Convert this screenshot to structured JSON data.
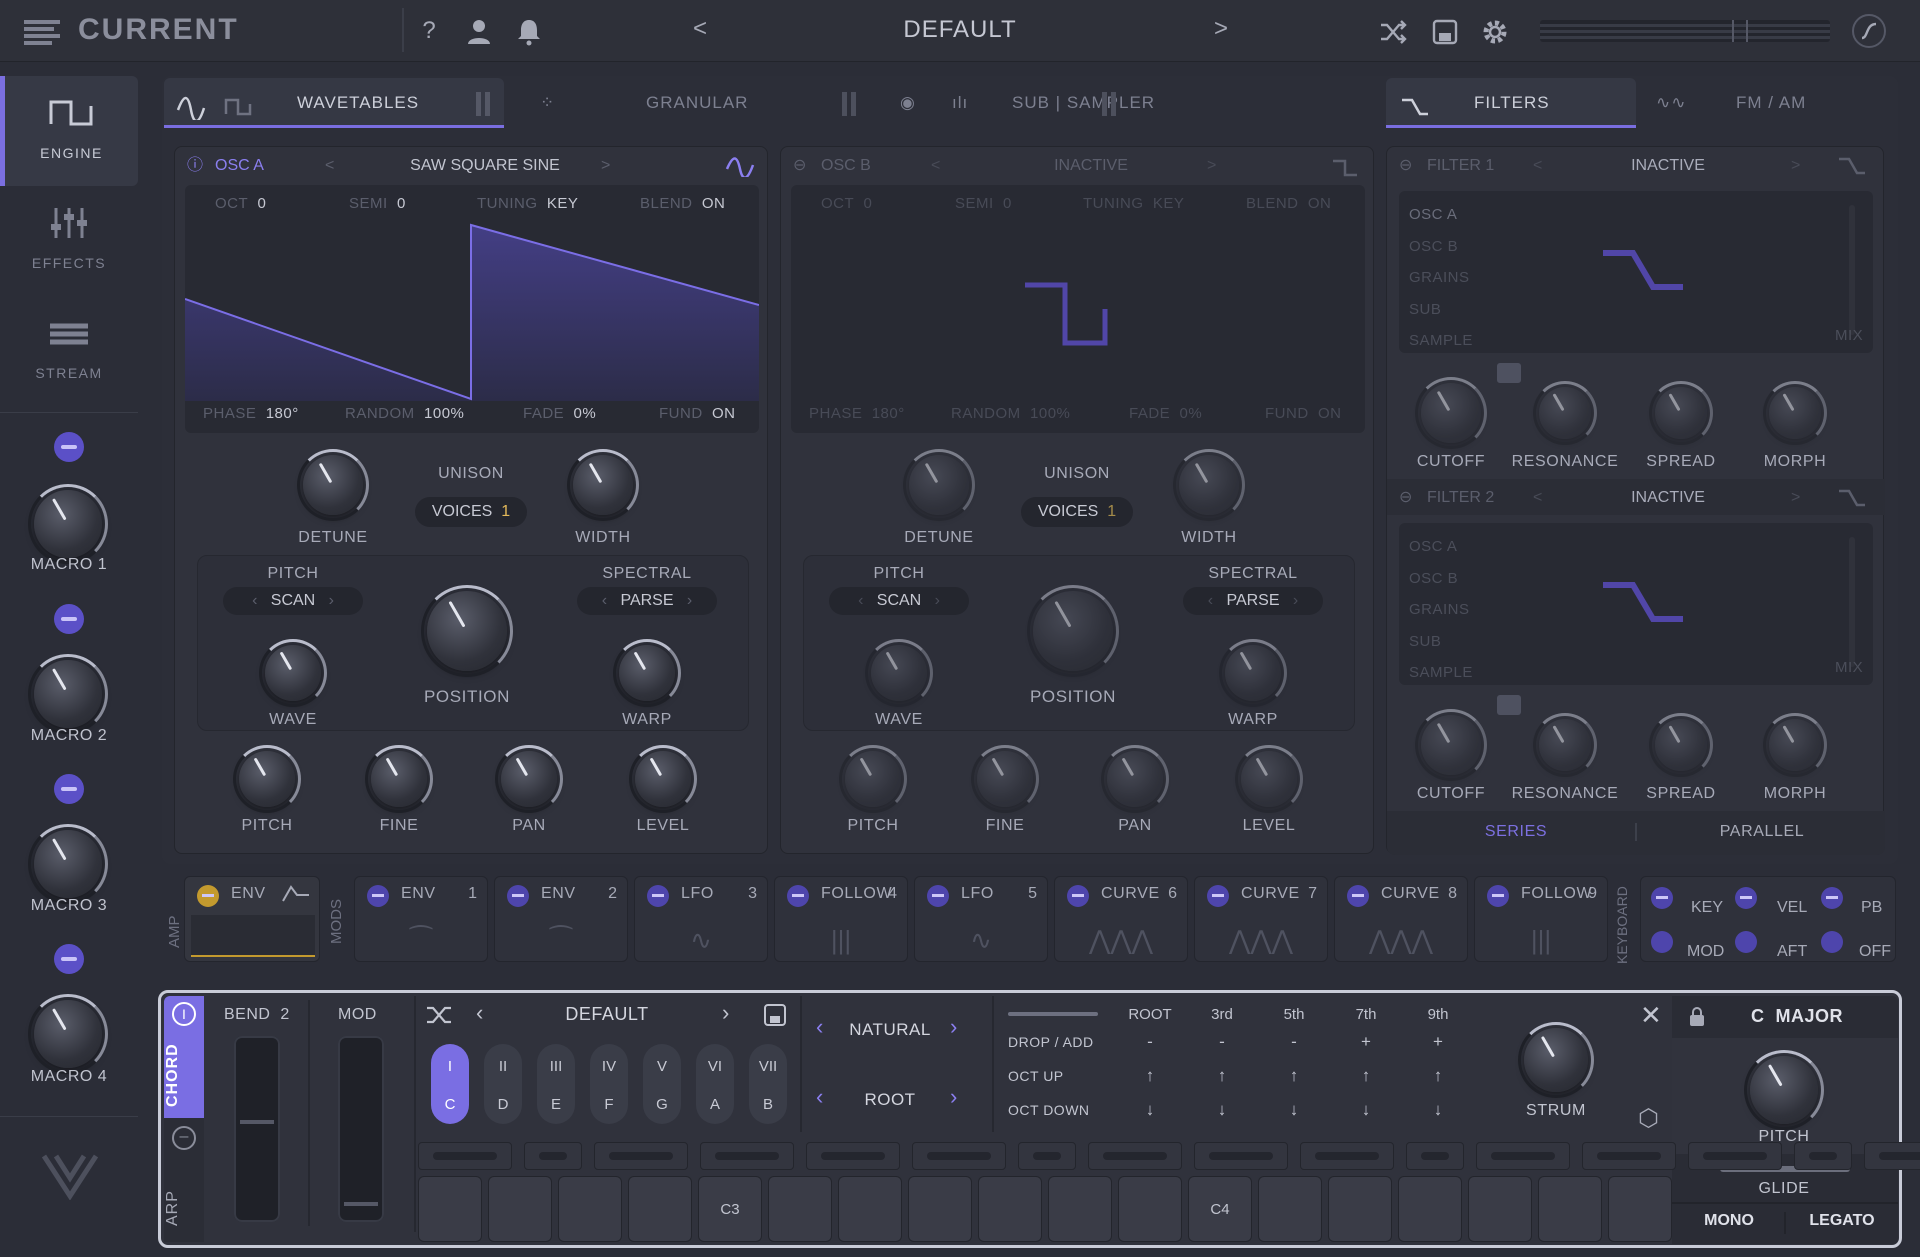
{
  "app": {
    "logo": "CURRENT",
    "preset": "DEFAULT"
  },
  "topbar": {
    "icons": [
      "help-icon",
      "user-icon",
      "bell-icon",
      "prev-chevron-icon",
      "next-chevron-icon",
      "shuffle-icon",
      "save-icon",
      "gear-icon",
      "curve-icon"
    ],
    "help_glyph": "?",
    "prev": "<",
    "next": ">"
  },
  "nav": {
    "items": [
      {
        "label": "ENGINE",
        "icon": "square-wave-icon"
      },
      {
        "label": "EFFECTS",
        "icon": "sliders-icon"
      },
      {
        "label": "STREAM",
        "icon": "stream-icon"
      }
    ]
  },
  "macros": [
    "MACRO 1",
    "MACRO 2",
    "MACRO 3",
    "MACRO 4"
  ],
  "tabs": {
    "wavetables": "WAVETABLES",
    "granular": "GRANULAR",
    "sub_sampler": "SUB | SAMPLER",
    "filters": "FILTERS",
    "fm_am": "FM / AM"
  },
  "osc_a": {
    "name": "OSC A",
    "wavetable": "SAW SQUARE SINE",
    "params": [
      {
        "k": "OCT",
        "v": "0"
      },
      {
        "k": "SEMI",
        "v": "0"
      },
      {
        "k": "TUNING",
        "v": "KEY"
      },
      {
        "k": "BLEND",
        "v": "ON"
      }
    ],
    "footer": [
      {
        "k": "PHASE",
        "v": "180°"
      },
      {
        "k": "RANDOM",
        "v": "100%"
      },
      {
        "k": "FADE",
        "v": "0%"
      },
      {
        "k": "FUND",
        "v": "ON"
      }
    ],
    "unison": "UNISON",
    "voices_label": "VOICES",
    "voices": "1",
    "detune": "DETUNE",
    "width": "WIDTH",
    "pitch_mode": "PITCH",
    "spectral_mode": "SPECTRAL",
    "scan": "SCAN",
    "parse": "PARSE",
    "wave": "WAVE",
    "position": "POSITION",
    "warp": "WARP",
    "bottom": [
      "PITCH",
      "FINE",
      "PAN",
      "LEVEL"
    ]
  },
  "osc_b": {
    "name": "OSC B",
    "wavetable": "INACTIVE",
    "params": [
      {
        "k": "OCT",
        "v": "0"
      },
      {
        "k": "SEMI",
        "v": "0"
      },
      {
        "k": "TUNING",
        "v": "KEY"
      },
      {
        "k": "BLEND",
        "v": "ON"
      }
    ],
    "footer": [
      {
        "k": "PHASE",
        "v": "180°"
      },
      {
        "k": "RANDOM",
        "v": "100%"
      },
      {
        "k": "FADE",
        "v": "0%"
      },
      {
        "k": "FUND",
        "v": "ON"
      }
    ],
    "unison": "UNISON",
    "voices_label": "VOICES",
    "voices": "1",
    "detune": "DETUNE",
    "width": "WIDTH",
    "pitch_mode": "PITCH",
    "spectral_mode": "SPECTRAL",
    "scan": "SCAN",
    "parse": "PARSE",
    "wave": "WAVE",
    "position": "POSITION",
    "warp": "WARP",
    "bottom": [
      "PITCH",
      "FINE",
      "PAN",
      "LEVEL"
    ]
  },
  "filter1": {
    "name": "FILTER 1",
    "type": "INACTIVE",
    "sources": [
      "OSC A",
      "OSC B",
      "GRAINS",
      "SUB",
      "SAMPLE"
    ],
    "mix": "MIX",
    "knobs": [
      "CUTOFF",
      "RESONANCE",
      "SPREAD",
      "MORPH"
    ]
  },
  "filter2": {
    "name": "FILTER 2",
    "type": "INACTIVE",
    "sources": [
      "OSC A",
      "OSC B",
      "GRAINS",
      "SUB",
      "SAMPLE"
    ],
    "mix": "MIX",
    "knobs": [
      "CUTOFF",
      "RESONANCE",
      "SPREAD",
      "MORPH"
    ]
  },
  "routing": {
    "series": "SERIES",
    "parallel": "PARALLEL"
  },
  "amp": {
    "label": "AMP",
    "env": "ENV"
  },
  "mods_label": "MODS",
  "mods": [
    {
      "name": "ENV",
      "num": "1",
      "wave": "⁀"
    },
    {
      "name": "ENV",
      "num": "2",
      "wave": "⁀"
    },
    {
      "name": "LFO",
      "num": "3",
      "wave": "∿"
    },
    {
      "name": "FOLLOW",
      "num": "4",
      "wave": "|||"
    },
    {
      "name": "LFO",
      "num": "5",
      "wave": "∿"
    },
    {
      "name": "CURVE",
      "num": "6",
      "wave": "⋀⋀⋀"
    },
    {
      "name": "CURVE",
      "num": "7",
      "wave": "⋀⋀⋀"
    },
    {
      "name": "CURVE",
      "num": "8",
      "wave": "⋀⋀⋀"
    },
    {
      "name": "FOLLOW",
      "num": "9",
      "wave": "|||"
    }
  ],
  "keyboard_label": "KEYBOARD",
  "keyboard_mods": [
    [
      "KEY",
      "VEL",
      "PB"
    ],
    [
      "MOD",
      "AFT",
      "OFF"
    ]
  ],
  "chord": {
    "tab_chord": "CHORD",
    "tab_arp": "ARP",
    "bend_label": "BEND",
    "bend_value": "2",
    "mod_label": "MOD",
    "preset": "DEFAULT",
    "scale_mode": "NATURAL",
    "voicing": "ROOT",
    "degrees": [
      {
        "r": "I",
        "n": "C"
      },
      {
        "r": "II",
        "n": "D"
      },
      {
        "r": "III",
        "n": "E"
      },
      {
        "r": "IV",
        "n": "F"
      },
      {
        "r": "V",
        "n": "G"
      },
      {
        "r": "VI",
        "n": "A"
      },
      {
        "r": "VII",
        "n": "B"
      }
    ],
    "intervals": [
      "ROOT",
      "3rd",
      "5th",
      "7th",
      "9th"
    ],
    "rows": [
      {
        "label": "DROP / ADD",
        "vals": [
          "-",
          "-",
          "-",
          "+",
          "+"
        ]
      },
      {
        "label": "OCT UP",
        "vals": [
          "↑",
          "↑",
          "↑",
          "↑",
          "↑"
        ]
      },
      {
        "label": "OCT DOWN",
        "vals": [
          "↓",
          "↓",
          "↓",
          "↓",
          "↓"
        ]
      }
    ],
    "strum": "STRUM",
    "key_root": "C",
    "key_scale": "MAJOR",
    "pitch": "PITCH",
    "glide": "GLIDE",
    "mono": "MONO",
    "legato": "LEGATO",
    "c3": "C3",
    "c4": "C4"
  }
}
